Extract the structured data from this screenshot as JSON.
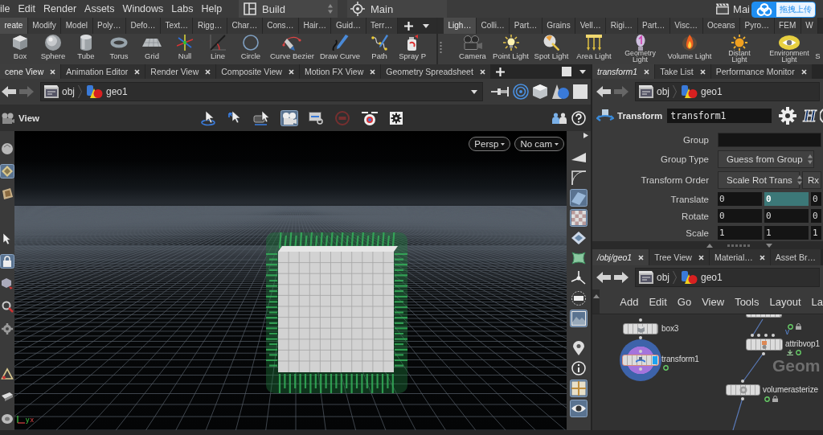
{
  "menu_bar": {
    "items": [
      "ile",
      "Edit",
      "Render",
      "Assets",
      "Windows",
      "Labs",
      "Help"
    ],
    "desktop": "Build",
    "context": "Main",
    "take": "Mai"
  },
  "upload_button": {
    "label": "拖拽上传"
  },
  "shelves": [
    {
      "tabs": [
        {
          "label": "reate",
          "selected": true
        },
        {
          "label": "Modify",
          "selected": false
        },
        {
          "label": "Model",
          "selected": false
        },
        {
          "label": "Poly…",
          "selected": false
        },
        {
          "label": "Defo…",
          "selected": false
        },
        {
          "label": "Text…",
          "selected": false
        },
        {
          "label": "Rigg…",
          "selected": false
        },
        {
          "label": "Char…",
          "selected": false
        },
        {
          "label": "Cons…",
          "selected": false
        },
        {
          "label": "Hair…",
          "selected": false
        },
        {
          "label": "Guid…",
          "selected": false
        },
        {
          "label": "Terr…",
          "selected": false
        }
      ],
      "tools": [
        "Box",
        "Sphere",
        "Tube",
        "Torus",
        "Grid",
        "Null",
        "Line",
        "Circle",
        "Curve Bezier",
        "Draw Curve",
        "Path",
        "Spray P"
      ]
    },
    {
      "tabs": [
        {
          "label": "Ligh…",
          "selected": true
        },
        {
          "label": "Colli…",
          "selected": false
        },
        {
          "label": "Part…",
          "selected": false
        },
        {
          "label": "Grains",
          "selected": false
        },
        {
          "label": "Vell…",
          "selected": false
        },
        {
          "label": "Rigi…",
          "selected": false
        },
        {
          "label": "Part…",
          "selected": false
        },
        {
          "label": "Visc…",
          "selected": false
        },
        {
          "label": "Oceans",
          "selected": false
        },
        {
          "label": "Pyro…",
          "selected": false
        },
        {
          "label": "FEM",
          "selected": false
        },
        {
          "label": "W",
          "selected": false
        }
      ],
      "tools": [
        "Camera",
        "Point Light",
        "Spot Light",
        "Area Light",
        "Geometry Light",
        "Volume Light",
        "Distant Light",
        "Environment Light",
        "S"
      ]
    }
  ],
  "scene_pane": {
    "tabs": [
      {
        "label": "cene View",
        "selected": true
      },
      {
        "label": "Animation Editor",
        "selected": false
      },
      {
        "label": "Render View",
        "selected": false
      },
      {
        "label": "Composite View",
        "selected": false
      },
      {
        "label": "Motion FX View",
        "selected": false
      },
      {
        "label": "Geometry Spreadsheet",
        "selected": false
      }
    ],
    "history": [
      {
        "kind": "back",
        "disabled": false
      },
      {
        "kind": "forward",
        "disabled": true
      }
    ],
    "path": [
      "obj",
      "geo1"
    ],
    "title": "View",
    "view_tools": [
      {
        "selected": false,
        "disabled": false
      },
      {
        "selected": false,
        "disabled": false
      },
      {
        "selected": false,
        "disabled": false
      },
      {
        "selected": true,
        "disabled": false
      },
      {
        "selected": false,
        "disabled": false
      },
      {
        "selected": false,
        "disabled": true
      },
      {
        "selected": false,
        "disabled": false
      },
      {
        "selected": false,
        "disabled": false
      }
    ],
    "left_tools": [
      {
        "selected": false
      },
      {
        "selected": true
      },
      {
        "selected": false
      },
      {
        "selected": false
      },
      {
        "selected": true
      },
      {
        "selected": false
      },
      {
        "selected": false
      },
      {
        "selected": false
      },
      {
        "selected": false
      },
      {
        "selected": false
      },
      {
        "selected": false
      }
    ],
    "right_tools": [
      {
        "selected": false
      },
      {
        "selected": false
      },
      {
        "selected": true
      },
      {
        "selected": true
      },
      {
        "selected": false
      },
      {
        "selected": false
      },
      {
        "selected": false
      },
      {
        "selected": false
      },
      {
        "selected": true
      },
      {
        "selected": false
      },
      {
        "selected": false
      },
      {
        "selected": true
      },
      {
        "selected": true
      }
    ],
    "camera_menus": [
      "Persp",
      "No cam"
    ],
    "axis_labels": [
      "y",
      "x"
    ]
  },
  "param_pane": {
    "tabs": [
      {
        "label": "transform1",
        "selected": true
      },
      {
        "label": "Take List",
        "selected": false
      },
      {
        "label": "Performance Monitor",
        "selected": false
      }
    ],
    "history": [
      {
        "kind": "back",
        "disabled": false
      },
      {
        "kind": "forward",
        "disabled": true
      }
    ],
    "path": [
      "obj",
      "geo1"
    ],
    "node_type": "Transform",
    "node_name": "transform1",
    "badge_letter": "H",
    "params": [
      {
        "kind": "text",
        "label": "Group"
      },
      {
        "kind": "menu",
        "label": "Group Type",
        "values": [
          "Guess from Group"
        ]
      },
      {
        "kind": "menu",
        "label": "Transform Order",
        "values": [
          "Scale Rot Trans",
          "Rx"
        ]
      },
      {
        "kind": "vector",
        "label": "Translate",
        "values": [
          {
            "value": "0",
            "selected": false
          },
          {
            "value": "0",
            "selected": true
          },
          {
            "value": "0",
            "selected": false
          }
        ]
      },
      {
        "kind": "vector",
        "label": "Rotate",
        "values": [
          {
            "value": "0",
            "selected": false
          },
          {
            "value": "0",
            "selected": false
          },
          {
            "value": "0",
            "selected": false
          }
        ]
      },
      {
        "kind": "vector",
        "label": "Scale",
        "values": [
          {
            "value": "1",
            "selected": false
          },
          {
            "value": "1",
            "selected": false
          },
          {
            "value": "1",
            "selected": false
          }
        ]
      }
    ]
  },
  "network_pane": {
    "tabs": [
      {
        "label": "/obj/geo1",
        "selected": true
      },
      {
        "label": "Tree View",
        "selected": false
      },
      {
        "label": "Material…",
        "selected": false
      },
      {
        "label": "Asset Br…",
        "selected": false
      }
    ],
    "history": [
      {
        "kind": "back",
        "disabled": false
      },
      {
        "kind": "forward",
        "disabled": false
      }
    ],
    "path": [
      "obj",
      "geo1"
    ],
    "menu": [
      "Add",
      "Edit",
      "Go",
      "View",
      "Tools",
      "Layout",
      "La"
    ],
    "context_label": "Geom",
    "nodes": [
      {
        "selected": false
      },
      {
        "name": "box3",
        "selected": false
      },
      {
        "name": "attribvop1",
        "selected": false,
        "marker": "v"
      },
      {
        "name": "transform1",
        "selected": true
      },
      {
        "name": "volumerasterize",
        "selected": false
      }
    ]
  }
}
